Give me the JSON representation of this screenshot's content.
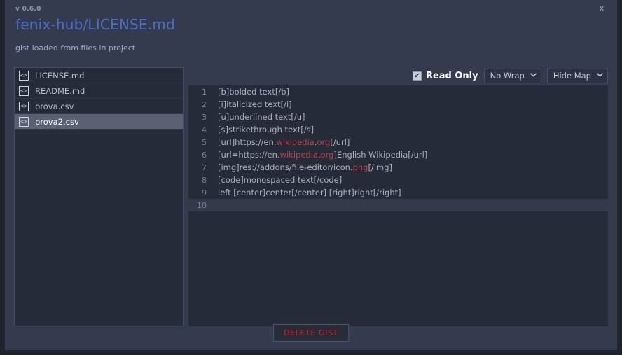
{
  "window": {
    "close_label": "x",
    "version": "v 0.6.0",
    "title": "fenix-hub/LICENSE.md",
    "subtitle": "gist loaded from files in project",
    "accent_title_color": "#4a6fc4",
    "subtitle_color": "#a0a8d0",
    "background_color": "#353b4f",
    "panel_color": "#262b38",
    "danger_color": "#e01b22"
  },
  "file_list": {
    "items": [
      {
        "label": "LICENSE.md",
        "icon": "code-file-icon",
        "selected": false
      },
      {
        "label": "README.md",
        "icon": "code-file-icon",
        "selected": false
      },
      {
        "label": "prova.csv",
        "icon": "code-file-icon",
        "selected": false
      },
      {
        "label": "prova2.csv",
        "icon": "code-file-icon",
        "selected": true
      }
    ]
  },
  "toolbar": {
    "read_only_label": "Read Only",
    "read_only_checked": true,
    "checkmark": "✔",
    "wrap_select": {
      "value": "No Wrap",
      "arrow": "chevron-down-icon",
      "arrow_glyph": "❯"
    },
    "map_select": {
      "value": "Hide Map",
      "arrow": "chevron-down-icon",
      "arrow_glyph": "❯"
    }
  },
  "editor": {
    "lines": [
      {
        "num": "1",
        "segments": [
          {
            "t": "[b]bolded text[/b]",
            "c": "plain"
          }
        ],
        "active": false
      },
      {
        "num": "2",
        "segments": [
          {
            "t": "[i]italicized text[/i]",
            "c": "plain"
          }
        ],
        "active": false
      },
      {
        "num": "3",
        "segments": [
          {
            "t": "[u]underlined text[/u]",
            "c": "plain"
          }
        ],
        "active": false
      },
      {
        "num": "4",
        "segments": [
          {
            "t": "[s]strikethrough text[/s]",
            "c": "plain"
          }
        ],
        "active": false
      },
      {
        "num": "5",
        "segments": [
          {
            "t": "[url]https://en.",
            "c": "plain"
          },
          {
            "t": "wikipedia",
            "c": "link"
          },
          {
            "t": ".",
            "c": "plain"
          },
          {
            "t": "org",
            "c": "link"
          },
          {
            "t": "[/url]",
            "c": "plain"
          }
        ],
        "active": false
      },
      {
        "num": "6",
        "segments": [
          {
            "t": "[url=https://en.",
            "c": "plain"
          },
          {
            "t": "wikipedia",
            "c": "link"
          },
          {
            "t": ".",
            "c": "plain"
          },
          {
            "t": "org",
            "c": "link"
          },
          {
            "t": "]English Wikipedia[/url]",
            "c": "plain"
          }
        ],
        "active": false
      },
      {
        "num": "7",
        "segments": [
          {
            "t": "[img]res://addons/file-editor/icon.",
            "c": "plain"
          },
          {
            "t": "png",
            "c": "link"
          },
          {
            "t": "[/img]",
            "c": "plain"
          }
        ],
        "active": false
      },
      {
        "num": "8",
        "segments": [
          {
            "t": "[code]monospaced text[/code]",
            "c": "plain"
          }
        ],
        "active": false
      },
      {
        "num": "9",
        "segments": [
          {
            "t": "left [center]center[/center] [right]right[/right]",
            "c": "plain"
          }
        ],
        "active": false
      },
      {
        "num": "10",
        "segments": [
          {
            "t": "",
            "c": "plain"
          }
        ],
        "active": true
      }
    ]
  },
  "footer": {
    "delete_label": "DELETE GIST"
  }
}
